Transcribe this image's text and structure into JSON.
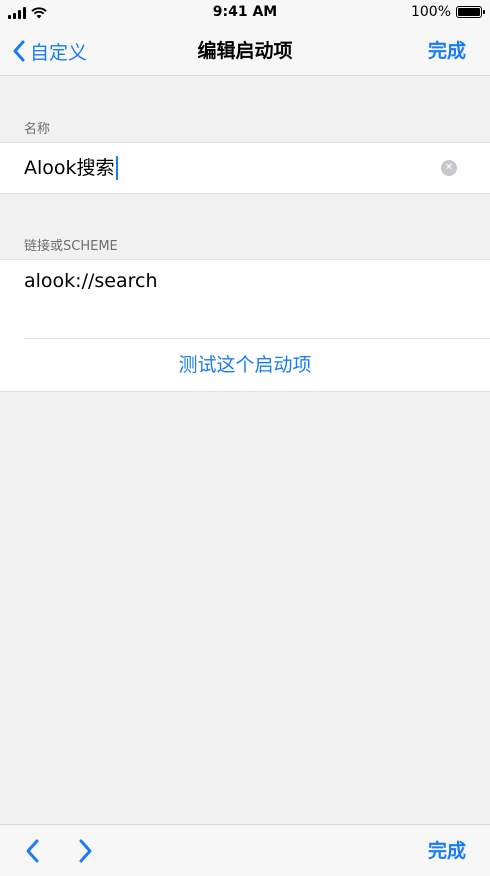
{
  "status_bar": {
    "time": "9:41 AM",
    "battery": "100%",
    "battery_level": 1.0
  },
  "nav": {
    "back_label": "自定义",
    "title": "编辑启动项",
    "done_label": "完成"
  },
  "name_section": {
    "header": "名称",
    "value": "Alook搜索"
  },
  "url_section": {
    "header": "链接或SCHEME",
    "value": "alook://search",
    "test_label": "测试这个启动项"
  },
  "toolbar": {
    "done_label": "完成"
  },
  "colors": {
    "accent": "#1a7cf2",
    "background": "#f1f1f1"
  },
  "icons": {
    "back": "chevron-left-icon",
    "prev": "chevron-left-icon",
    "next": "chevron-right-icon",
    "clear": "clear-circle-icon",
    "signal": "signal-bars-icon",
    "wifi": "wifi-icon",
    "battery": "battery-icon"
  }
}
